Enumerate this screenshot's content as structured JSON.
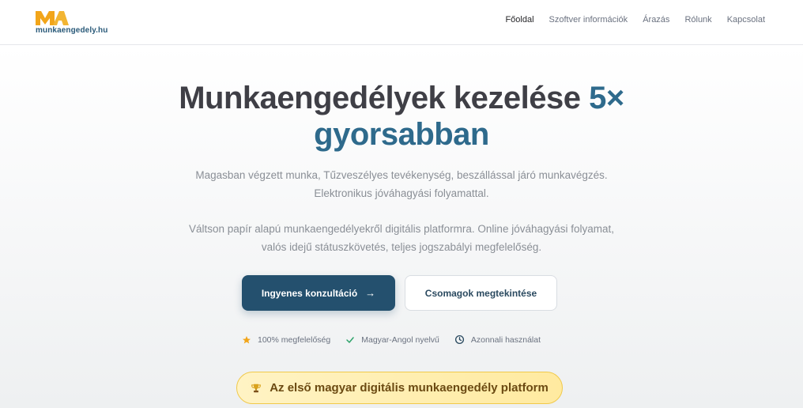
{
  "header": {
    "logo_text": "munkaengedely.hu",
    "nav": [
      {
        "label": "Főoldal",
        "active": true
      },
      {
        "label": "Szoftver információk",
        "active": false
      },
      {
        "label": "Árazás",
        "active": false
      },
      {
        "label": "Rólunk",
        "active": false
      },
      {
        "label": "Kapcsolat",
        "active": false
      }
    ]
  },
  "hero": {
    "title_main": "Munkaengedélyek kezelése",
    "title_accent_1": "5×",
    "title_accent_2": "gyorsabban",
    "subtitle_line1": "Magasban végzett munka, Tűzveszélyes tevékenység, beszállással járó munkavégzés.",
    "subtitle_line2": "Elektronikus jóváhagyási folyamattal.",
    "description_line1": "Váltson papír alapú munkaengedélyekről digitális platformra. Online jóváhagyási folyamat,",
    "description_line2": "valós idejű státuszkövetés, teljes jogszabályi megfelelőség.",
    "primary_button": "Ingyenes konzultáció",
    "primary_arrow": "→",
    "secondary_button": "Csomagok megtekintése",
    "features": [
      {
        "icon": "star-icon",
        "label": "100% megfelelőség"
      },
      {
        "icon": "check-icon",
        "label": "Magyar-Angol nyelvű"
      },
      {
        "icon": "clock-icon",
        "label": "Azonnali használat"
      }
    ],
    "badge": {
      "icon": "trophy-icon",
      "label": "Az első magyar digitális munkaengedély platform"
    }
  },
  "colors": {
    "brand_dark": "#24506e",
    "accent_text": "#2e6a8c",
    "logo_orange": "#f2a51a",
    "badge_bg": "#fff3c4"
  }
}
